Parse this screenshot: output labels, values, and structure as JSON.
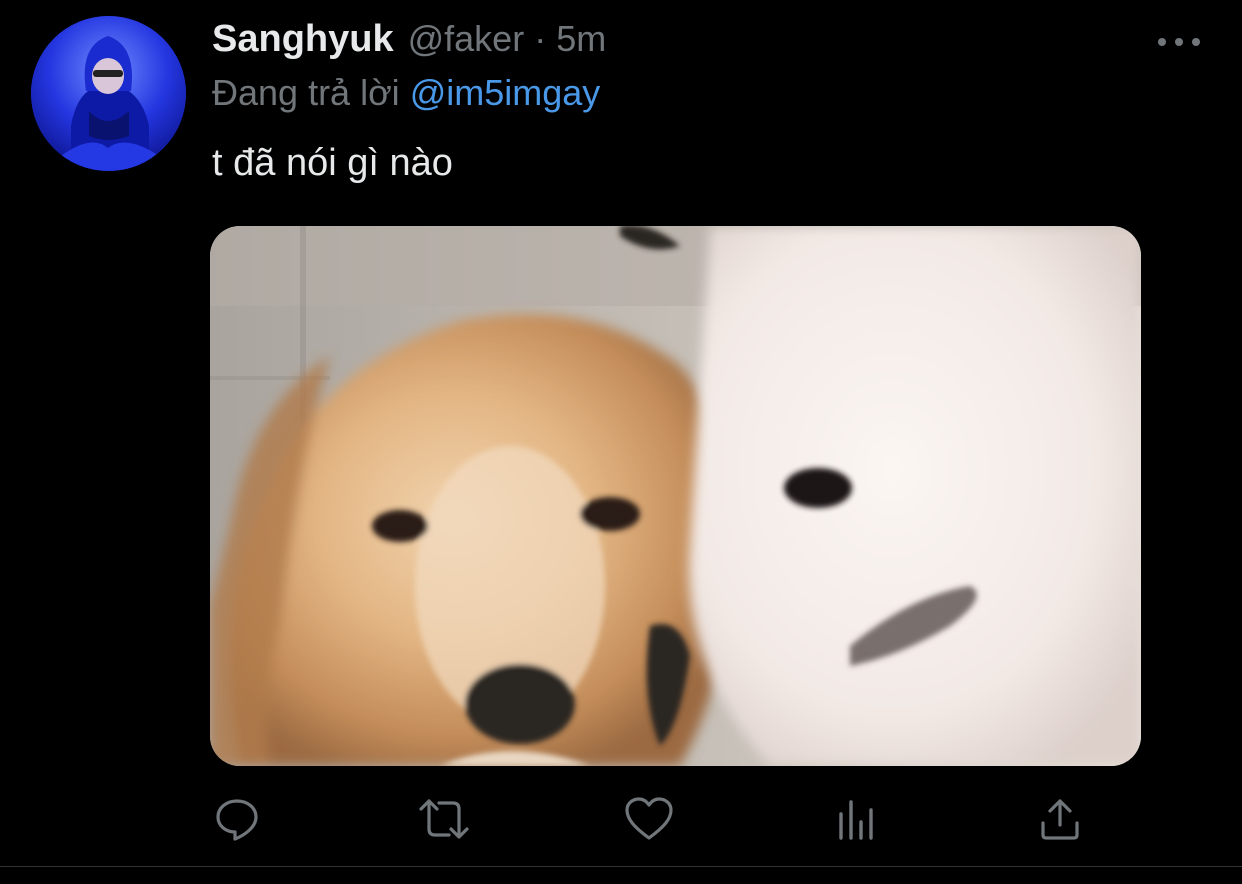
{
  "tweet": {
    "display_name": "Sanghyuk",
    "handle": "@faker",
    "separator": "·",
    "time": "5m",
    "reply_prefix": "Đang trả lời",
    "reply_to": "@im5imgay",
    "text": "t đã nói gì nào"
  },
  "icons": {
    "more": "more-horizontal-icon",
    "reply": "reply-icon",
    "retweet": "retweet-icon",
    "like": "heart-icon",
    "analytics": "analytics-icon",
    "share": "share-icon"
  },
  "colors": {
    "background": "#000000",
    "primary_text": "#e7e9ea",
    "secondary_text": "#71767b",
    "link": "#4a99e9"
  }
}
